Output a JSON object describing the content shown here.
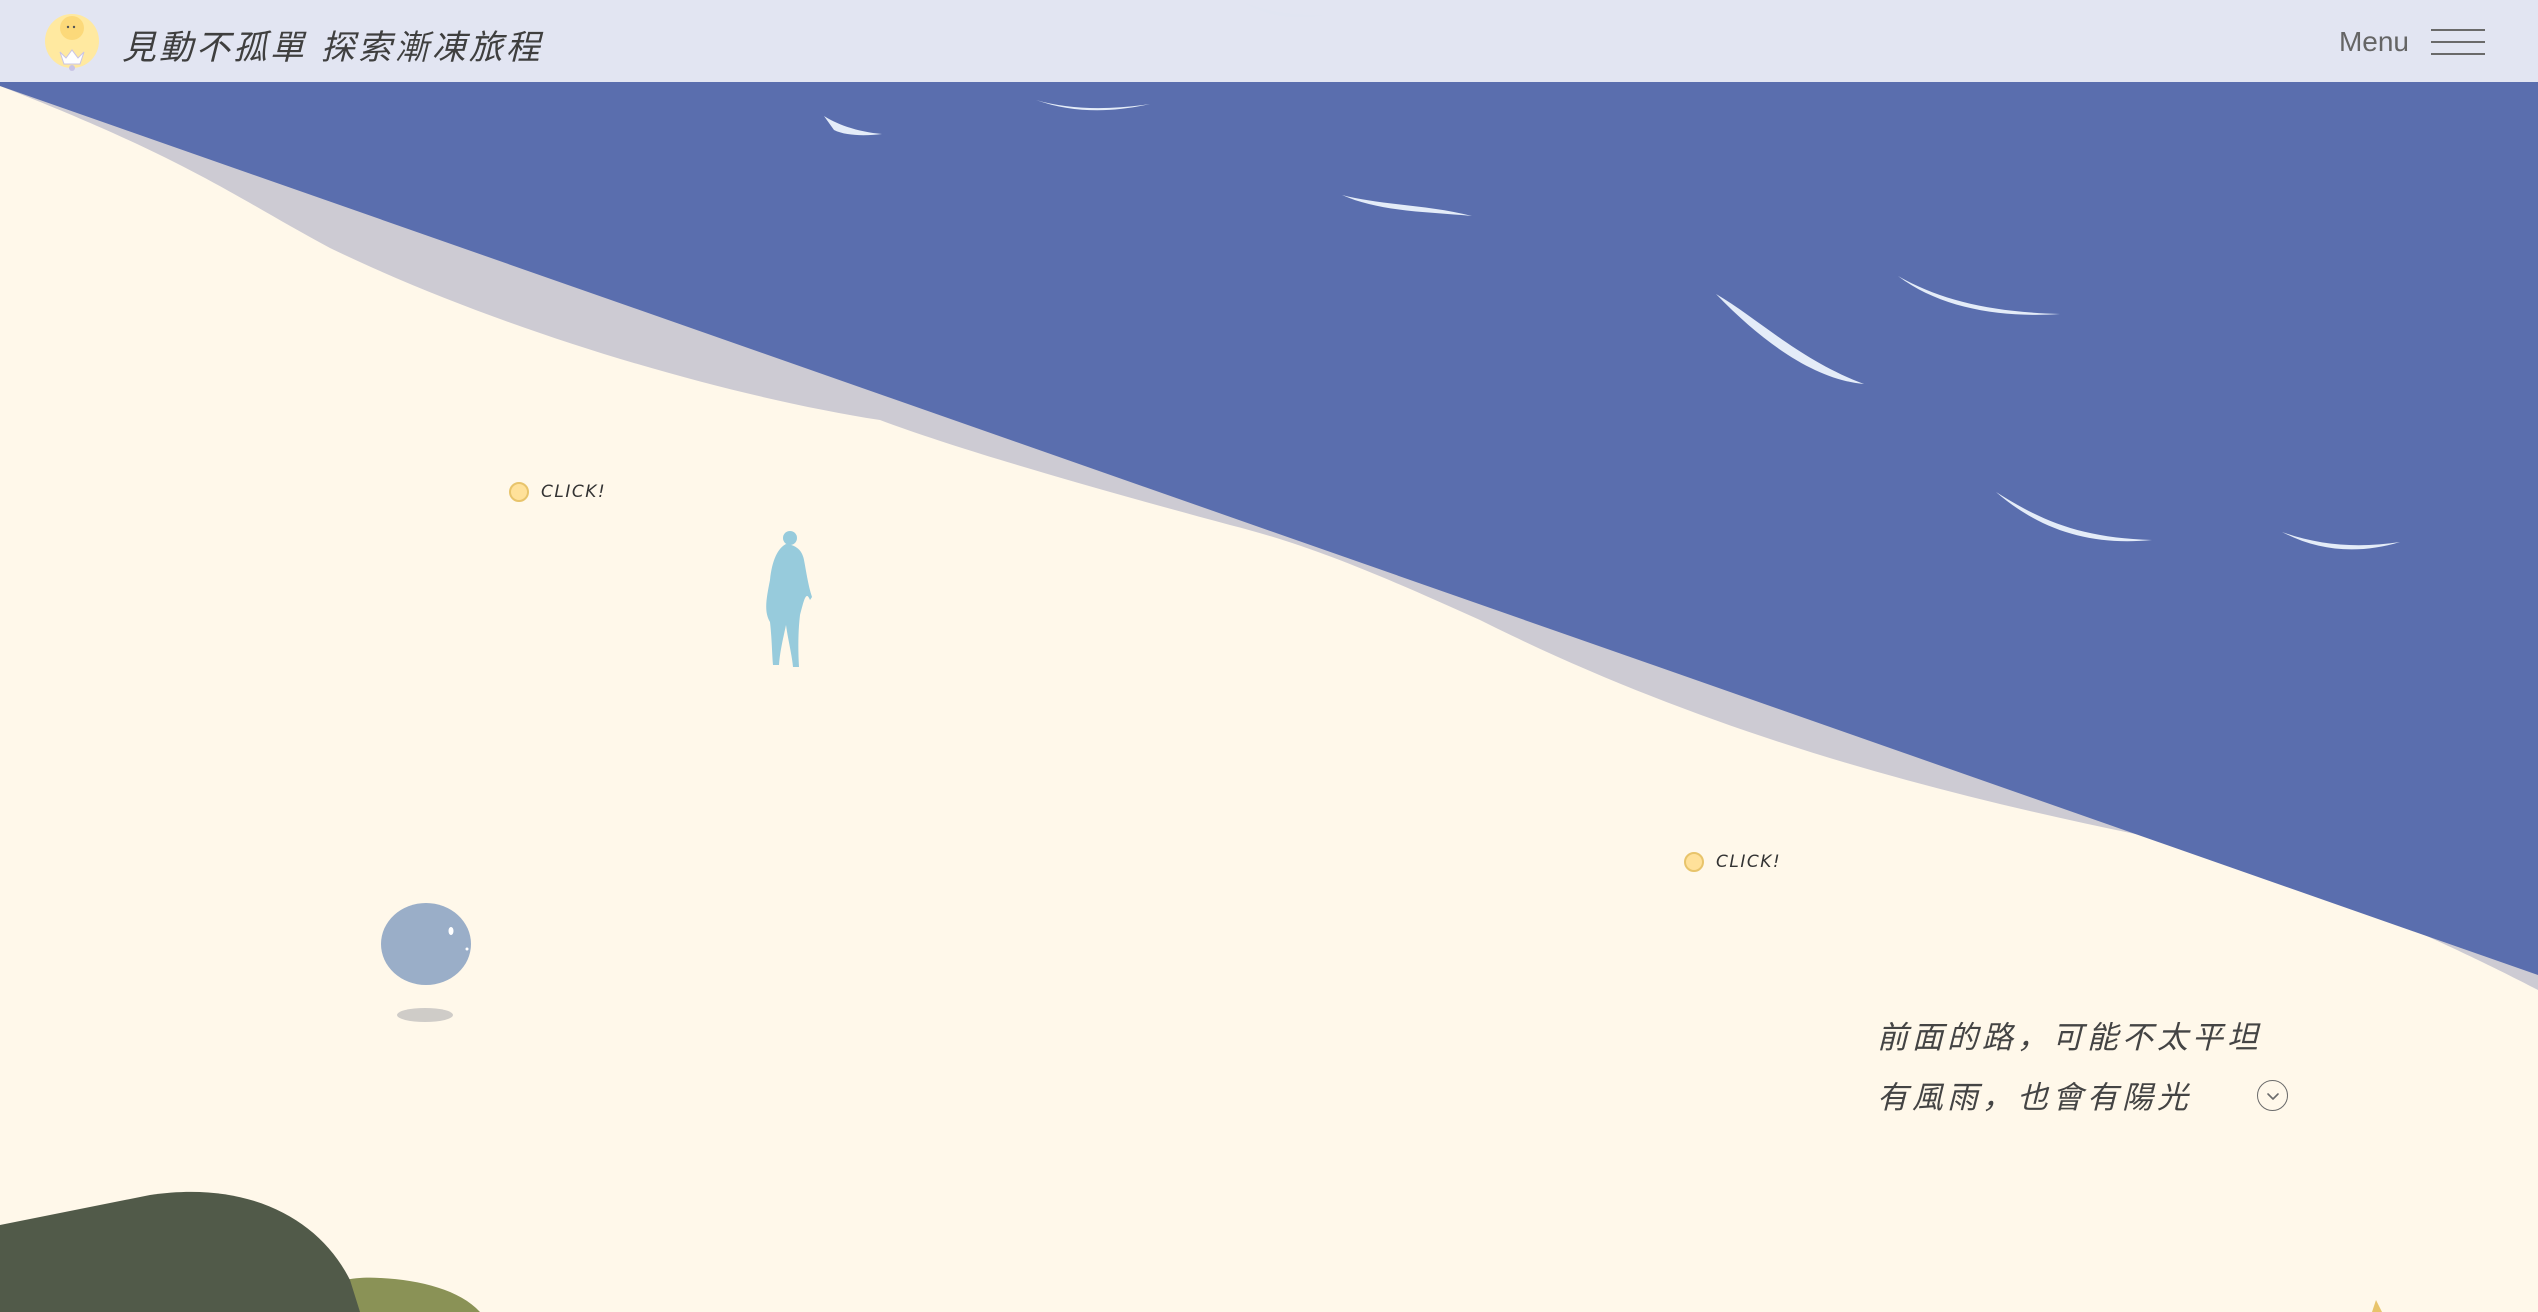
{
  "header": {
    "logo_name": "sun-flower-logo",
    "site_title": "見動不孤單 探索漸凍旅程",
    "menu_label": "Menu",
    "menu_icon": "hamburger-icon"
  },
  "scene": {
    "hotspots": [
      {
        "label": "CLICK!"
      },
      {
        "label": "CLICK!"
      }
    ],
    "story_lines": [
      "前面的路，可能不太平坦",
      "有風雨，也會有陽光"
    ],
    "scroll_icon": "chevron-down-icon"
  },
  "colors": {
    "header_bg": "#e1e4f1",
    "sea": "#5a6eae",
    "beach": "#fff8ea",
    "shore_shadow": "#cdcbd3",
    "wave": "#e4ecf8",
    "person": "#97cbdc",
    "ball": "#9aaec8",
    "hotspot_dot": "#ffe19a",
    "bush_dark": "#515a49",
    "bush_light": "#8a9256",
    "text": "#3f3f3f"
  }
}
